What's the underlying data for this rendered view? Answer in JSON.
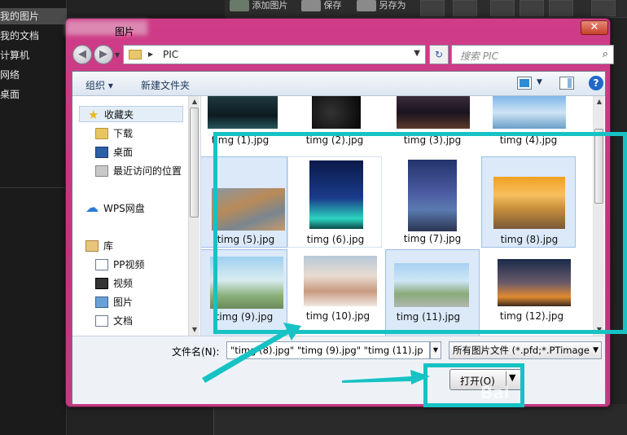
{
  "bg_app": {
    "sidebar_items": [
      "我的图片",
      "我的文档",
      "计算机",
      "网络",
      "桌面"
    ],
    "toolbar_buttons": [
      "添加图片",
      "保存",
      "另存为"
    ]
  },
  "dialog": {
    "title": "图片",
    "close_label": "✕",
    "address": {
      "separator": "▸",
      "path": "PIC"
    },
    "search_placeholder": "搜索 PIC",
    "commands": {
      "organize": "组织 ▾",
      "new_folder": "新建文件夹"
    },
    "nav": {
      "favorites": "收藏夹",
      "downloads": "下载",
      "desktop": "桌面",
      "recent": "最近访问的位置",
      "wps": "WPS网盘",
      "library": "库",
      "pp_video": "PP视频",
      "video": "视频",
      "pictures": "图片",
      "documents": "文档"
    },
    "files": [
      {
        "name": "timg (1).jpg",
        "selected": false
      },
      {
        "name": "timg (2).jpg",
        "selected": false
      },
      {
        "name": "timg (3).jpg",
        "selected": false
      },
      {
        "name": "timg (4).jpg",
        "selected": false
      },
      {
        "name": "timg (5).jpg",
        "selected": true
      },
      {
        "name": "timg (6).jpg",
        "selected": false
      },
      {
        "name": "timg (7).jpg",
        "selected": false
      },
      {
        "name": "timg (8).jpg",
        "selected": true
      },
      {
        "name": "timg (9).jpg",
        "selected": true
      },
      {
        "name": "timg (10).jpg",
        "selected": false
      },
      {
        "name": "timg (11).jpg",
        "selected": true
      },
      {
        "name": "timg (12).jpg",
        "selected": false
      }
    ],
    "footer": {
      "filename_label": "文件名(N):",
      "filename_value": "\"timg (8).jpg\" \"timg (9).jpg\" \"timg (11).jp",
      "filetype_value": "所有图片文件 (*.pfd;*.PTimage",
      "open_label": "打开(O)"
    }
  },
  "watermark": "Bai",
  "colors": {
    "annotation": "#16c2c4",
    "titlebar": "#c2337f"
  }
}
